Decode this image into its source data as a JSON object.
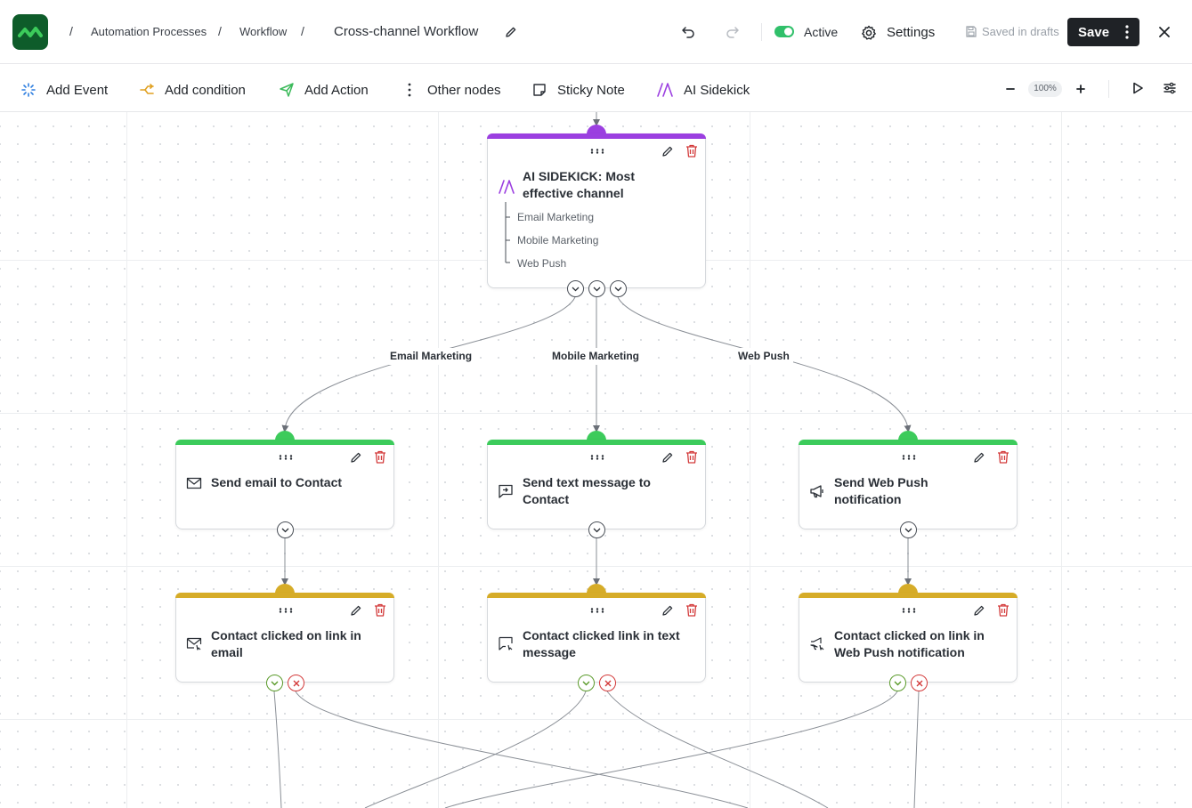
{
  "header": {
    "breadcrumbs": [
      "Automation Processes",
      "Workflow"
    ],
    "workflow_title": "Cross-channel Workflow",
    "status_label": "Active",
    "settings_label": "Settings",
    "saved_label": "Saved in drafts",
    "save_label": "Save"
  },
  "toolbar": {
    "add_event": "Add Event",
    "add_condition": "Add condition",
    "add_action": "Add Action",
    "other_nodes": "Other nodes",
    "sticky_note": "Sticky Note",
    "ai_sidekick": "AI Sidekick",
    "zoom": "100%"
  },
  "colors": {
    "ai": "#9b3fe0",
    "action": "#3ccb5b",
    "event": "#d6ac28",
    "yes": "#5a9a2a",
    "no": "#d33a3a"
  },
  "ai_node": {
    "title_line1": "AI SIDEKICK: Most",
    "title_line2": "effective channel",
    "options": [
      "Email Marketing",
      "Mobile Marketing",
      "Web Push"
    ]
  },
  "edge_labels": [
    "Email Marketing",
    "Mobile Marketing",
    "Web Push"
  ],
  "action_nodes": [
    {
      "line1": "Send email to Contact",
      "line2": "",
      "icon": "mail-icon"
    },
    {
      "line1": "Send text message to",
      "line2": "Contact",
      "icon": "sms-icon"
    },
    {
      "line1": "Send Web Push",
      "line2": "notification",
      "icon": "megaphone-icon"
    }
  ],
  "event_nodes": [
    {
      "line1": "Contact clicked on link in",
      "line2": "email",
      "icon": "mail-click-icon"
    },
    {
      "line1": "Contact clicked link in text",
      "line2": "message",
      "icon": "sms-click-icon"
    },
    {
      "line1": "Contact clicked on link in",
      "line2": "Web Push notification",
      "icon": "megaphone-click-icon"
    }
  ]
}
